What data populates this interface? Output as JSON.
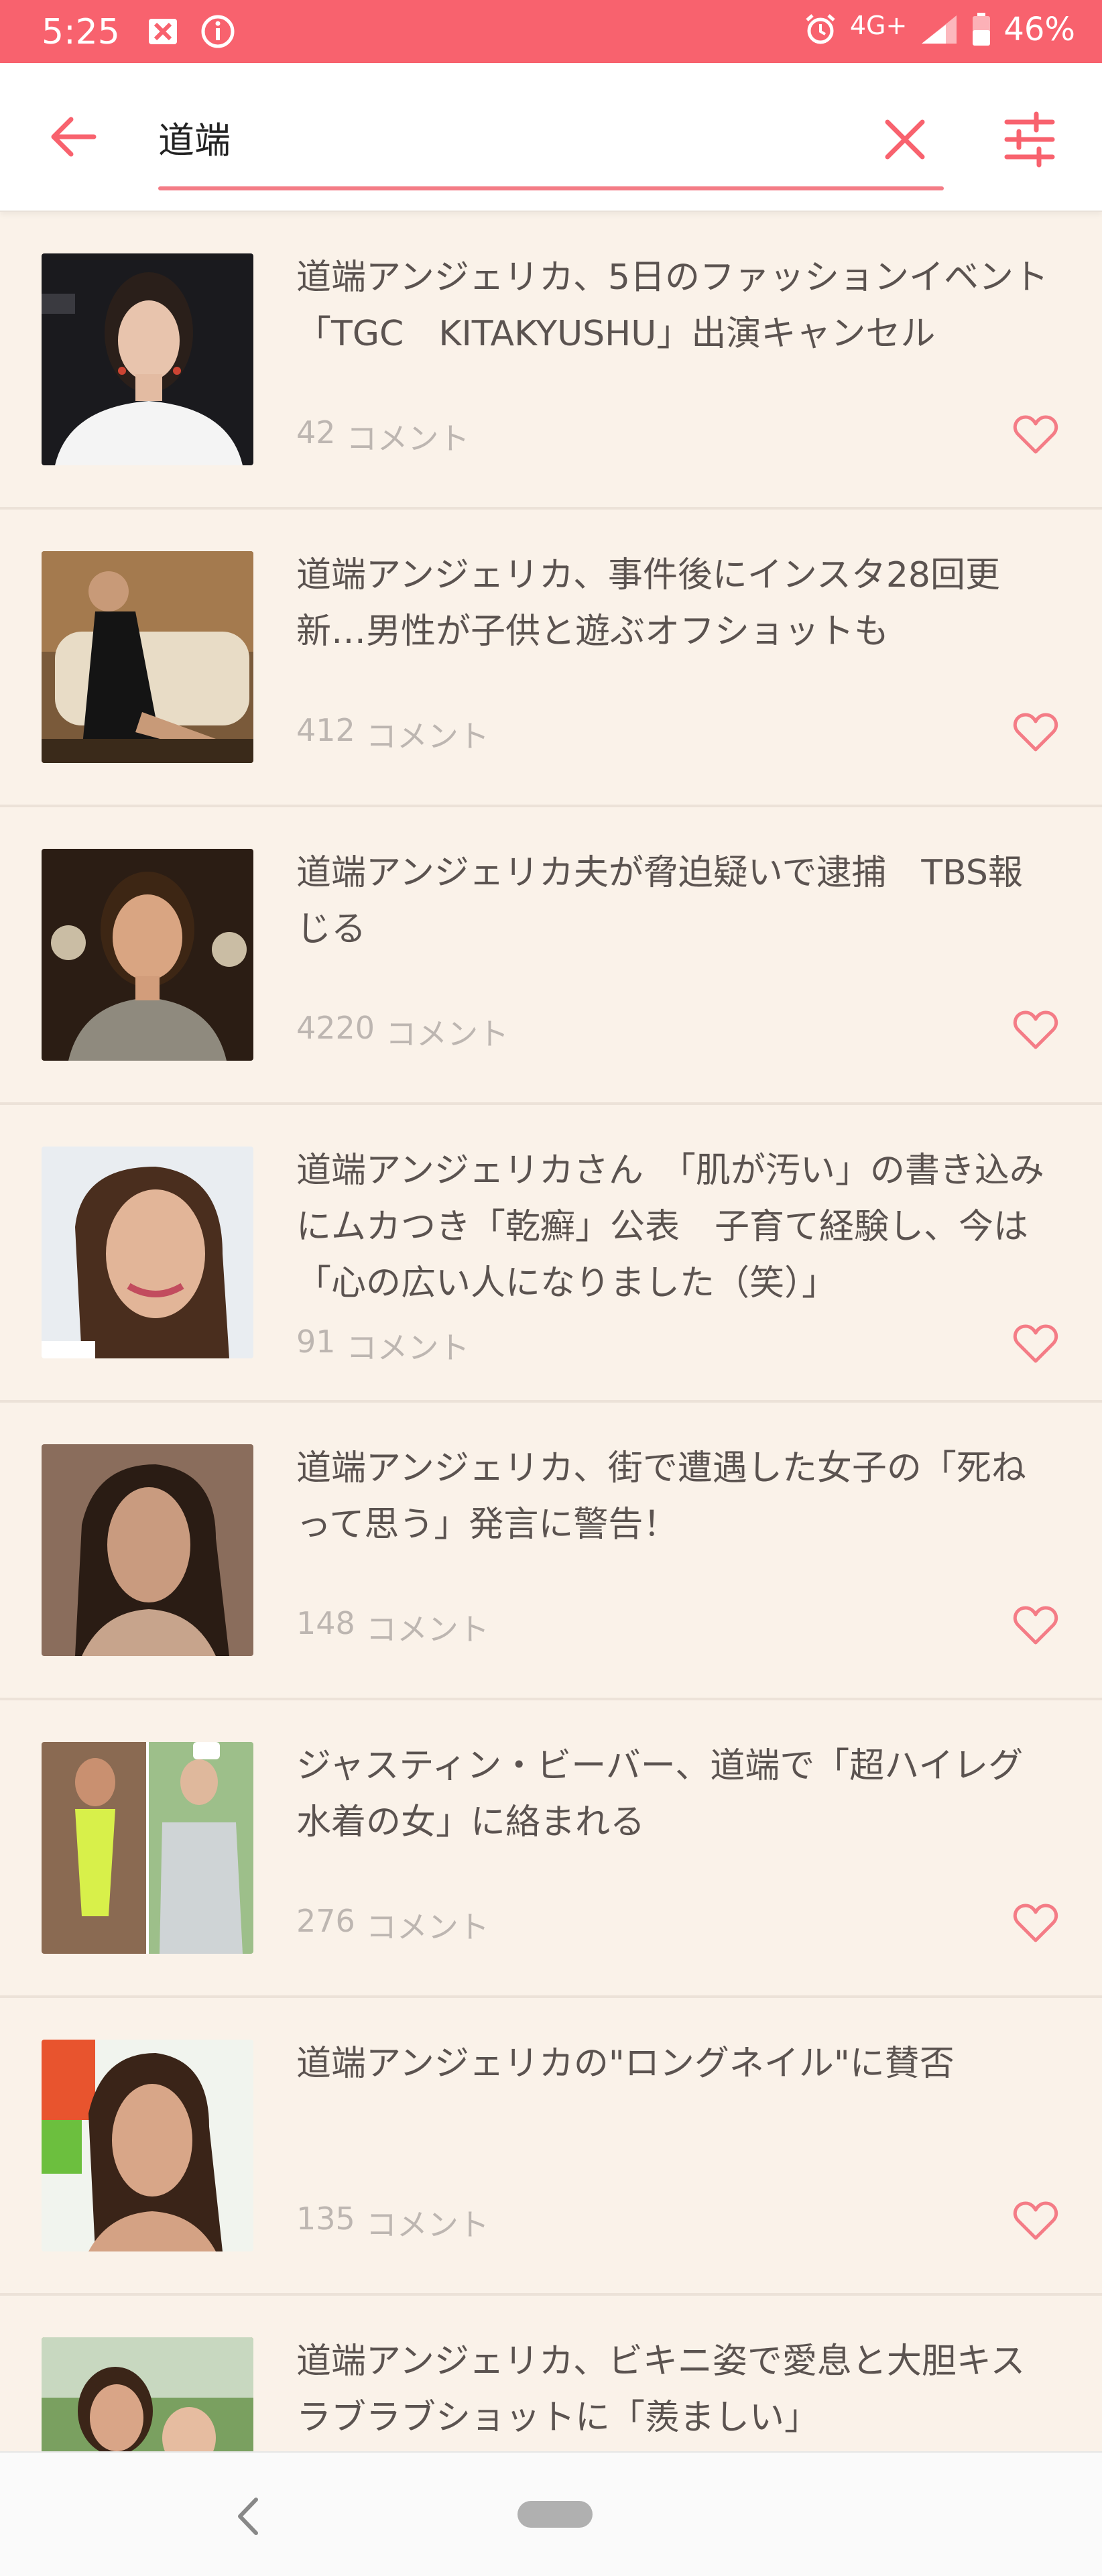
{
  "status_bar": {
    "time": "5:25",
    "network": "4G+",
    "battery": "46%",
    "colors": {
      "background": "#f8626e"
    }
  },
  "search": {
    "query": "道端",
    "icons": {
      "back": "arrow-left-icon",
      "clear": "close-icon",
      "filter": "sliders-icon"
    },
    "accent_color": "#f8626e"
  },
  "results": [
    {
      "title": "道端アンジェリカ、5日のファッションイベント「TGC　KITAKYUSHU」出演キャンセル",
      "comments": "42",
      "comment_label": "コメント"
    },
    {
      "title": "道端アンジェリカ、事件後にインスタ28回更新…男性が子供と遊ぶオフショットも",
      "comments": "412",
      "comment_label": "コメント"
    },
    {
      "title": "道端アンジェリカ夫が脅迫疑いで逮捕　TBS報じる",
      "comments": "4220",
      "comment_label": "コメント"
    },
    {
      "title": "道端アンジェリカさん　「肌が汚い」の書き込みにムカつき「乾癬」公表　子育て経験し、今は「心の広い人になりました（笑）」",
      "comments": "91",
      "comment_label": "コメント"
    },
    {
      "title": "道端アンジェリカ、街で遭遇した女子の「死ねって思う」発言に警告！",
      "comments": "148",
      "comment_label": "コメント"
    },
    {
      "title": "ジャスティン・ビーバー、道端で「超ハイレグ水着の女」に絡まれる",
      "comments": "276",
      "comment_label": "コメント"
    },
    {
      "title": "道端アンジェリカの\"ロングネイル\"に賛否",
      "comments": "135",
      "comment_label": "コメント"
    },
    {
      "title": "道端アンジェリカ、ビキニ姿で愛息と大胆キス　ラブラブショットに「羨ましい」",
      "comments": "",
      "comment_label": ""
    }
  ]
}
